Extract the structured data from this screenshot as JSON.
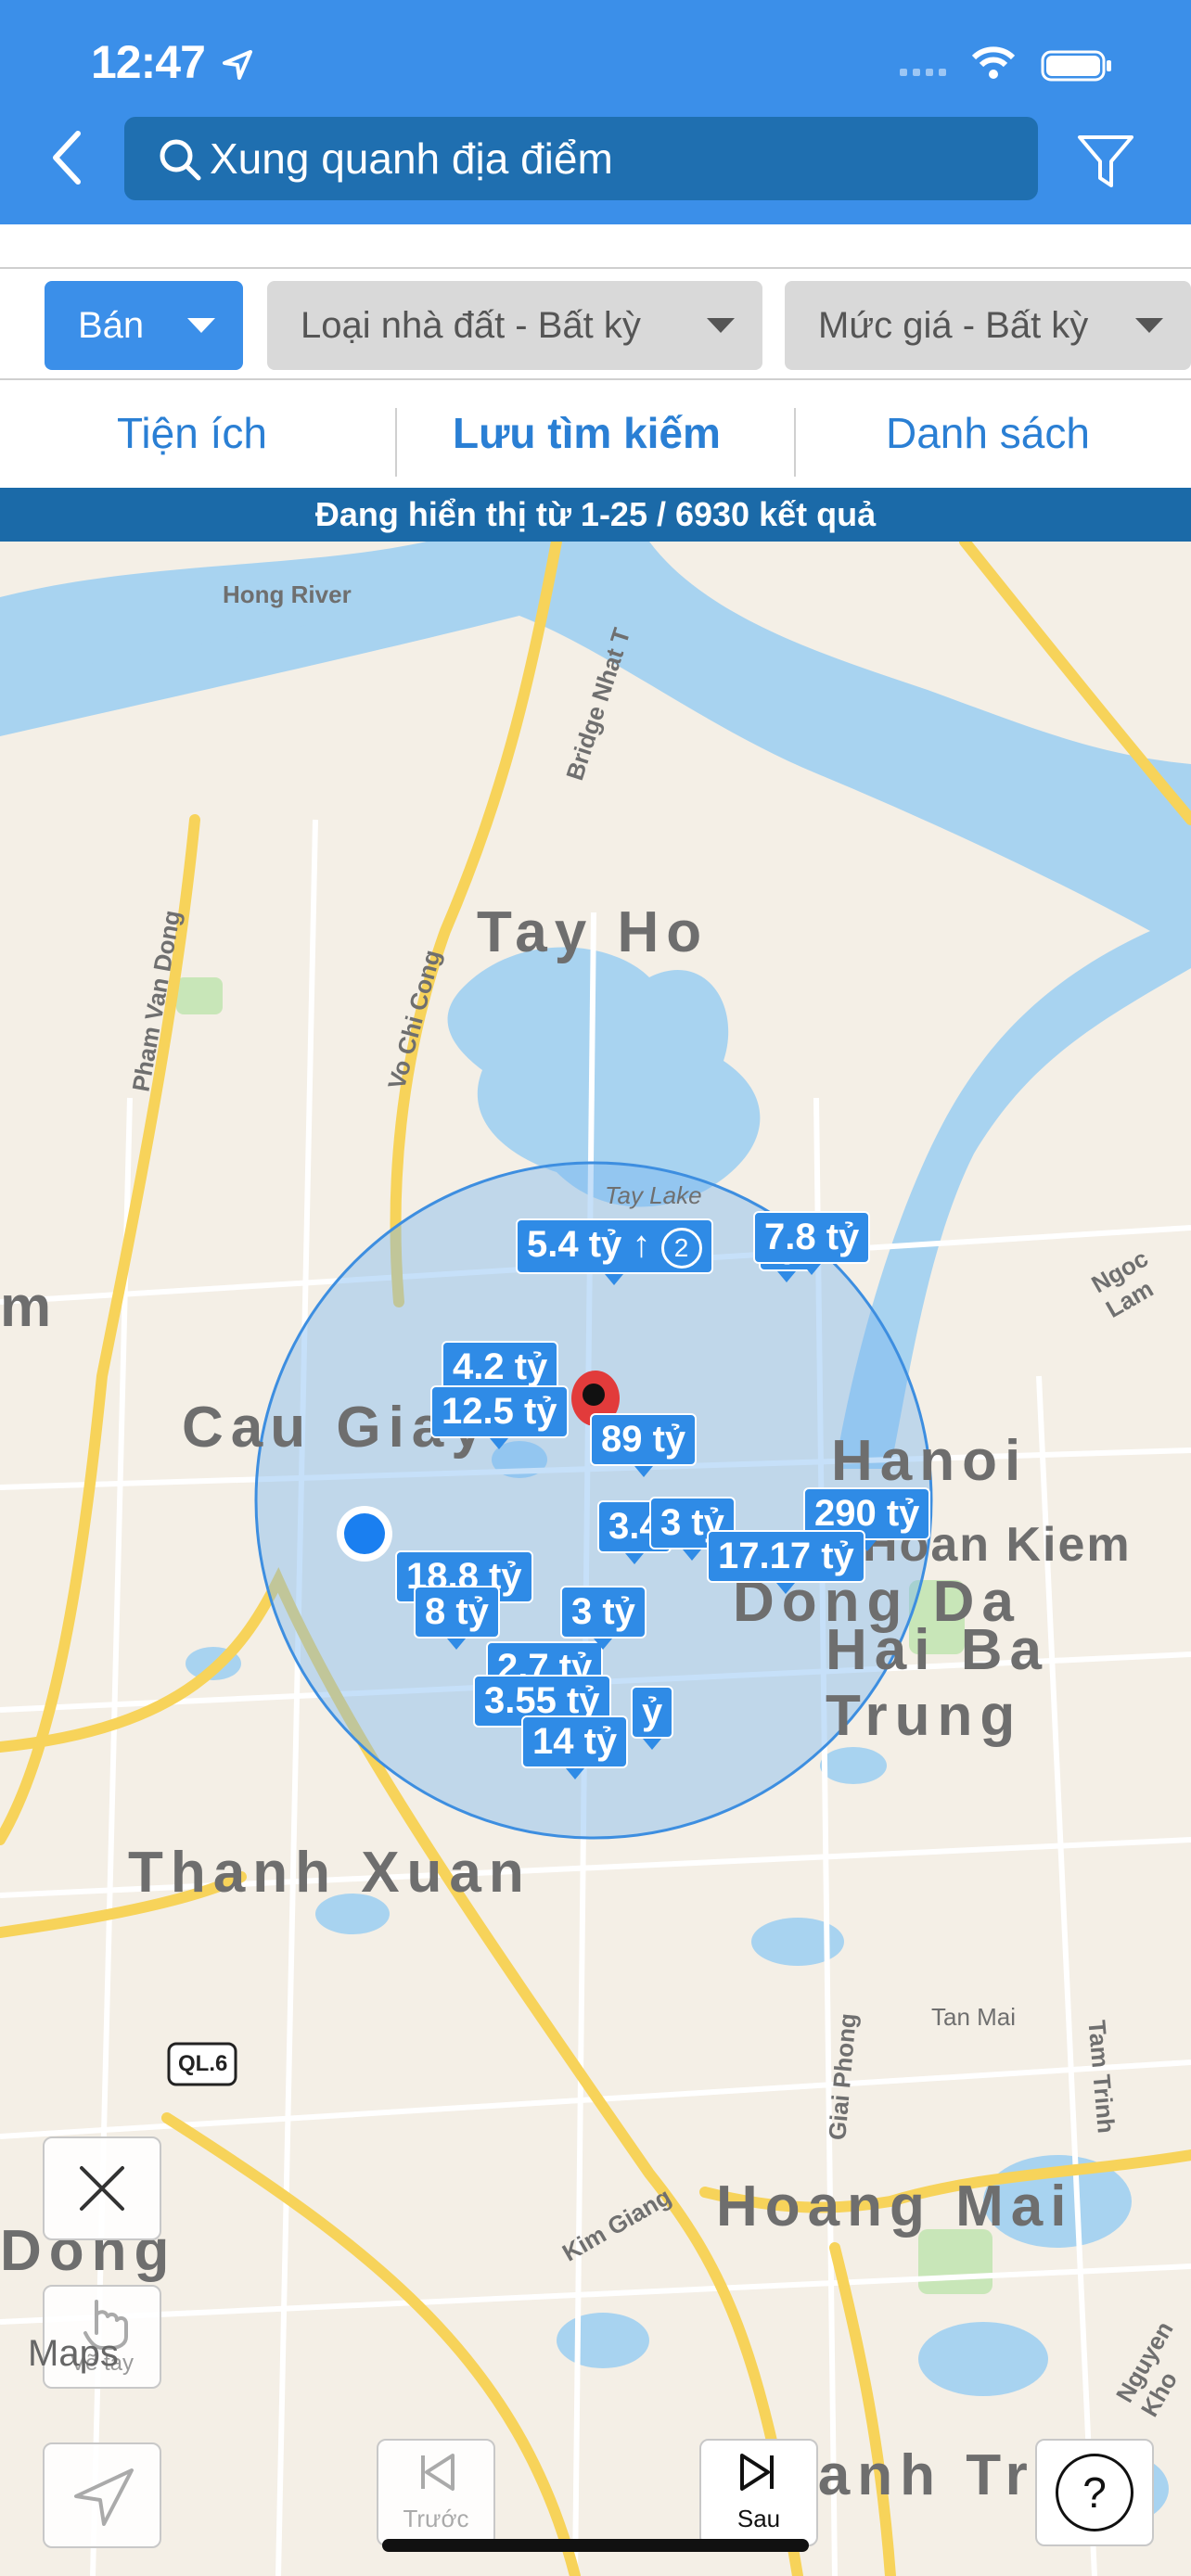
{
  "status_bar": {
    "time": "12:47"
  },
  "header": {
    "search_placeholder": "Xung quanh địa điểm"
  },
  "filters": {
    "type_label": "Bán",
    "property_label": "Loại nhà đất - Bất kỳ",
    "price_label": "Mức giá - Bất kỳ"
  },
  "tabs": [
    {
      "label": "Tiện ích"
    },
    {
      "label": "Lưu tìm kiếm"
    },
    {
      "label": "Danh sách"
    }
  ],
  "results_text": "Đang hiển thị từ 1-25 / 6930 kết quả",
  "map": {
    "places": [
      "Tay Ho",
      "Cau Giay",
      "Hanoi",
      "Hoan Kiem",
      "Hai Ba Trung",
      "Thanh Xuan",
      "Hoang Mai",
      "Dong",
      "Thanh Tri",
      "m",
      "Dong Da"
    ],
    "streets": [
      "Hong River",
      "Bridge Nhat T",
      "Pham Van Dong",
      "Vo Chi Cong",
      "Tay Lake",
      "Giai Phong",
      "Tan Mai",
      "Tam Trinh",
      "Kim Giang",
      "Ngoc Lam",
      "Nguyen Kho",
      "QL.6"
    ],
    "price_markers": [
      "5.4 tỷ",
      "7.8 tỷ",
      "4.2 tỷ",
      "12.5 tỷ",
      "89 tỷ",
      "3.4",
      "3 tỷ",
      "290 tỷ",
      "17.17 tỷ",
      "18.8 tỷ",
      "8 tỷ",
      "3 tỷ",
      "3.55 tỷ",
      "14 tỷ",
      "ty",
      "ỷ",
      "2.7 tỷ"
    ],
    "cluster_count": "2",
    "attribution": "Maps"
  },
  "controls": {
    "draw_label": "Vẽ tay",
    "prev_label": "Trước",
    "next_label": "Sau",
    "help_label": "?"
  }
}
